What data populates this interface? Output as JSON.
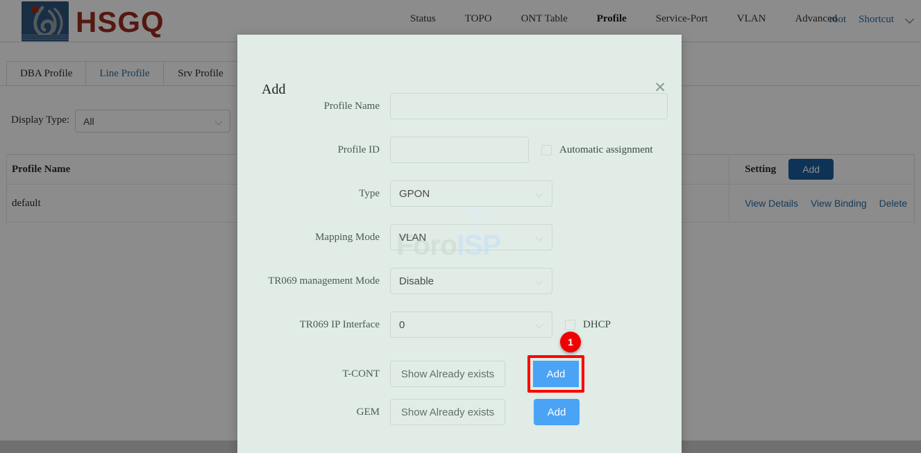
{
  "header": {
    "logo_text": "HSGQ",
    "logo_icon": "hsgq-logo-icon",
    "nav": [
      {
        "label": "Status",
        "active": false
      },
      {
        "label": "TOPO",
        "active": false
      },
      {
        "label": "ONT Table",
        "active": false
      },
      {
        "label": "Profile",
        "active": true
      },
      {
        "label": "Service-Port",
        "active": false
      },
      {
        "label": "VLAN",
        "active": false
      },
      {
        "label": "Advanced",
        "active": false
      }
    ],
    "user": "root",
    "shortcut": "Shortcut"
  },
  "tabs": [
    {
      "label": "DBA Profile",
      "active": false
    },
    {
      "label": "Line Profile",
      "active": true
    },
    {
      "label": "Srv Profile",
      "active": false
    },
    {
      "label": "",
      "active": false
    }
  ],
  "filter": {
    "label": "Display Type:",
    "value": "All"
  },
  "table": {
    "columns": [
      "Profile Name",
      "Setting"
    ],
    "add_label": "Add",
    "rows": [
      {
        "profile_name": "default",
        "actions": [
          "View Details",
          "View Binding",
          "Delete"
        ]
      }
    ]
  },
  "dialog": {
    "title": "Add",
    "close_icon": "close-icon",
    "fields": {
      "profile_name": {
        "label": "Profile Name",
        "value": "",
        "placeholder": ""
      },
      "profile_id": {
        "label": "Profile ID",
        "value": "",
        "placeholder": ""
      },
      "automatic_assignment": {
        "label": "Automatic assignment",
        "checked": false
      },
      "type": {
        "label": "Type",
        "value": "GPON"
      },
      "mapping_mode": {
        "label": "Mapping Mode",
        "value": "VLAN"
      },
      "tr069_management_mode": {
        "label": "TR069 management Mode",
        "value": "Disable"
      },
      "tr069_ip_interface": {
        "label": "TR069 IP Interface",
        "value": "0"
      },
      "dhcp": {
        "label": "DHCP",
        "checked": false
      },
      "tcont": {
        "label": "T-CONT",
        "show_label": "Show Already exists",
        "add_label": "Add"
      },
      "gem": {
        "label": "GEM",
        "show_label": "Show Already exists",
        "add_label": "Add"
      }
    }
  },
  "annotation": {
    "badge_number": "1"
  },
  "watermark": {
    "part_a": "Foro",
    "part_b": "ISP"
  },
  "colors": {
    "brand_red": "#9b2d20",
    "brand_blue": "#2d547c",
    "link_blue": "#2b6ca3",
    "button_blue": "#4aa3f5",
    "table_button_blue": "#1b5e9e",
    "dialog_bg": "#e0ece5",
    "highlight_red": "#ff0000",
    "badge_red": "#f00000"
  }
}
